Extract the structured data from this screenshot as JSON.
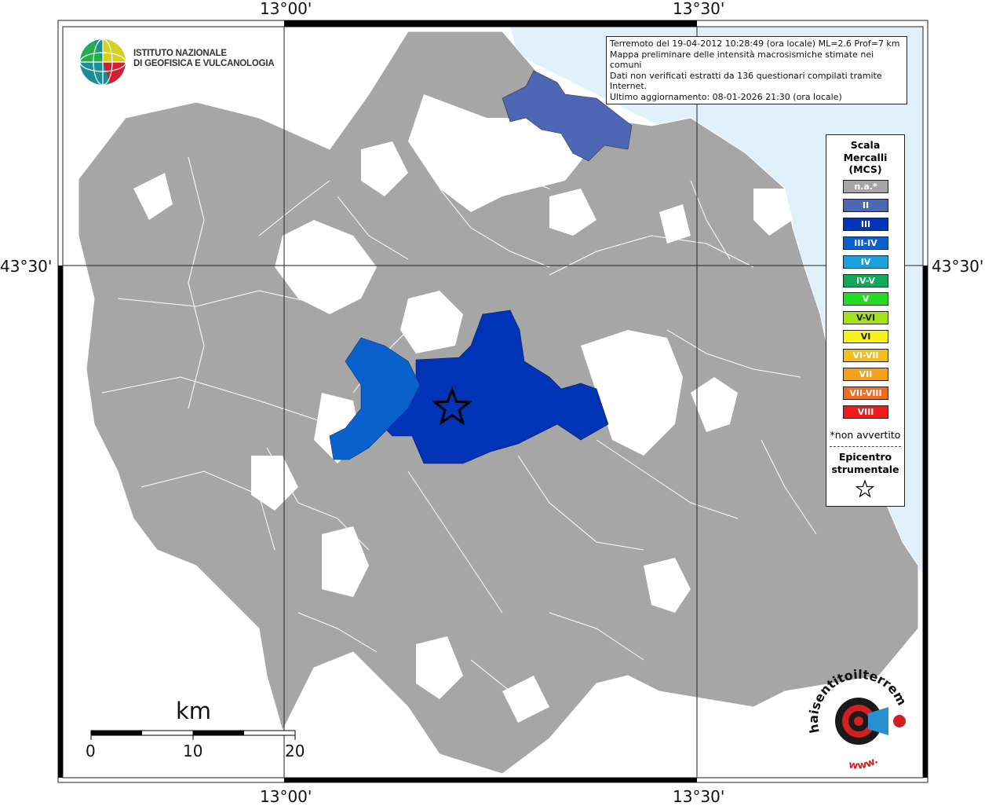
{
  "map": {
    "info_lines": [
      "Terremoto del 19-04-2012 10:28:49 (ora locale) ML=2.6 Prof=7 km",
      "Mappa preliminare delle intensità macrosismiche stimate nei comuni",
      "Dati non verificati estratti da 136 questionari compilati tramite Internet.",
      "Ultimo aggiornamento: 08-01-2026 21:30 (ora locale)"
    ],
    "lon_labels": [
      "13°00'",
      "13°30'"
    ],
    "lat_labels": [
      "43°30'"
    ],
    "logo_lines": [
      "ISTITUTO NAZIONALE",
      "DI GEOFISICA E VULCANOLOGIA"
    ],
    "scale": {
      "unit": "km",
      "ticks": [
        "0",
        "10",
        "20"
      ]
    },
    "watermark": {
      "text": "haisentitoilterremoto.it",
      "www": "www."
    },
    "colors": {
      "not_felt": "#a6a6a6",
      "sea": "#e0f1fb",
      "II": "#4d67b4",
      "III": "#0033b6",
      "III-IV": "#0a60cc"
    }
  },
  "legend": {
    "title_lines": [
      "Scala",
      "Mercalli",
      "(MCS)"
    ],
    "items": [
      {
        "label": "n.a.*",
        "color": "#a6a6a6"
      },
      {
        "label": "II",
        "color": "#4d67b4"
      },
      {
        "label": "III",
        "color": "#0033b6"
      },
      {
        "label": "III-IV",
        "color": "#0a60cc"
      },
      {
        "label": "IV",
        "color": "#1ba0e0"
      },
      {
        "label": "IV-V",
        "color": "#13a85a"
      },
      {
        "label": "V",
        "color": "#22dd22"
      },
      {
        "label": "V-VI",
        "color": "#a6e11c"
      },
      {
        "label": "VI",
        "color": "#f7f21a"
      },
      {
        "label": "VI-VII",
        "color": "#f4bc1c"
      },
      {
        "label": "VII",
        "color": "#f6a01a"
      },
      {
        "label": "VII-VIII",
        "color": "#f36a1c"
      },
      {
        "label": "VIII",
        "color": "#f01a1a"
      }
    ],
    "note": "*non avvertito",
    "epicenter_lines": [
      "Epicentro",
      "strumentale"
    ]
  }
}
